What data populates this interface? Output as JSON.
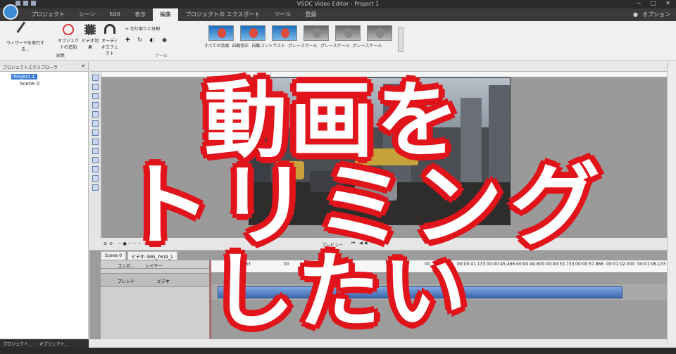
{
  "window": {
    "title": "VSDC Video Editor - Project 1",
    "options_label": "オプション"
  },
  "tabs": [
    "プロジェクト",
    "シーン",
    "Edit",
    "表示",
    "編集",
    "プロジェクトの エクスポート",
    "ツール",
    "登録"
  ],
  "active_tab": "編集",
  "ribbon": {
    "wizard_label": "ウィザードを実行する...",
    "add_object_label": "オブジェクトの追加",
    "video_effect_label": "ビデオ効果",
    "audio_effect_label": "オーディオエフェクト",
    "edit_group_label": "編集",
    "cut_split_label": "切り取りと分割",
    "tools_group_label": "ツール",
    "quick_styles": [
      "すべての効果",
      "自動修正",
      "自動コントラスト",
      "グレースケール",
      "グレースケール",
      "グレースケール"
    ]
  },
  "left_panel": {
    "header": "プロジェクトエクスプローラ",
    "project": "Project 1",
    "scene": "Scene 0",
    "bottom_tabs": [
      "プロジェクト...",
      "オブジェクト..."
    ]
  },
  "timeline": {
    "tabs": [
      "Scene 0",
      "ビデオ: IMG_7619_1"
    ],
    "preview_label": "プレビュー",
    "header_cols": [
      "コンポ...",
      "レイヤー"
    ],
    "track_row": [
      "ブレンド",
      "ビデオ"
    ],
    "time_ticks": [
      "00:00:41.133",
      "00:00:45.466",
      "00:00:49.600",
      "00:00:53.733",
      "00:00:57.866",
      "00:01:02.000",
      "00:01:06.133"
    ],
    "partial_ticks": [
      "41.133",
      "00",
      "00"
    ]
  },
  "overlay": {
    "line1": "動画を",
    "line2": "トリミング",
    "line3": "したい"
  },
  "colors": {
    "overlay_stroke": "#e0141a",
    "overlay_fill": "#ffffff",
    "accent": "#3b7fd8"
  }
}
